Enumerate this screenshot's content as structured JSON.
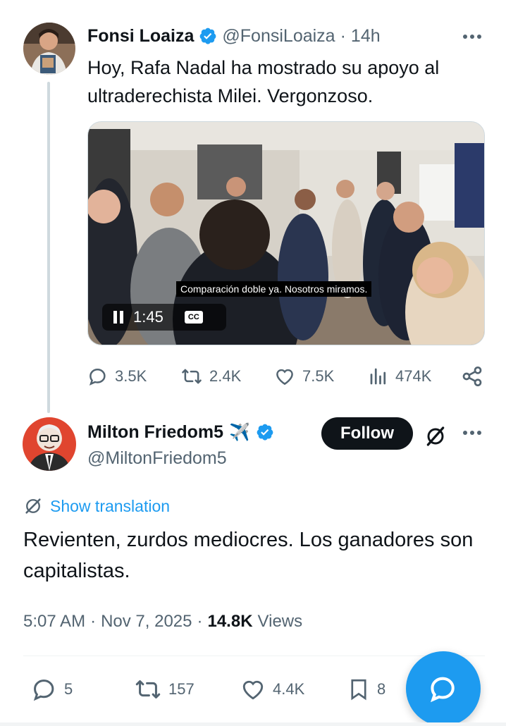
{
  "tweet1": {
    "name": "Fonsi Loaiza",
    "handle": "@FonsiLoaiza",
    "dot": "·",
    "time": "14h",
    "text": "Hoy, Rafa Nadal ha mostrado su apoyo al ultraderechista Milei. Vergonzoso.",
    "video": {
      "subtitle": "Comparación doble ya. Nosotros miramos.",
      "duration": "1:45",
      "cc_label": "CC"
    },
    "actions": {
      "replies": "3.5K",
      "reposts": "2.4K",
      "likes": "7.5K",
      "views": "474K"
    }
  },
  "tweet2": {
    "name": "Milton Friedom5",
    "emoji": "✈️",
    "handle": "@MiltonFriedom5",
    "follow_label": "Follow",
    "translate_label": "Show translation",
    "text": "Revienten, zurdos mediocres. Los ganadores son capitalistas.",
    "time": "5:07 AM",
    "date": "Nov 7, 2025",
    "dot": "·",
    "views_count": "14.8K",
    "views_label": "Views",
    "actions": {
      "replies": "5",
      "reposts": "157",
      "likes": "4.4K",
      "bookmarks": "8"
    }
  },
  "colors": {
    "verified": "#1d9bf0",
    "link": "#1d9bf0",
    "muted": "#536471",
    "follow_bg": "#0f1419",
    "fab": "#1d9bf0"
  },
  "icons": [
    "verified-icon",
    "more-icon",
    "reply-icon",
    "repost-icon",
    "like-icon",
    "views-icon",
    "share-icon",
    "bookmark-icon",
    "grok-icon",
    "translate-icon",
    "compose-icon",
    "pause-icon",
    "cc-icon"
  ]
}
